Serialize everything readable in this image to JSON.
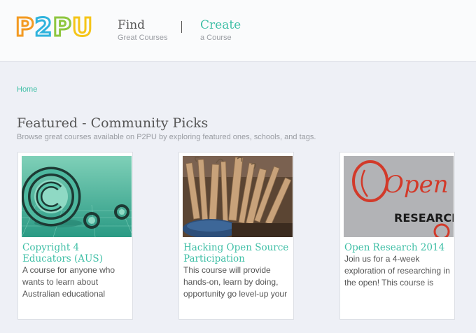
{
  "logo": {
    "letters": [
      {
        "char": "P",
        "color": "#f39a22"
      },
      {
        "char": "2",
        "color": "#2fb3dd"
      },
      {
        "char": "P",
        "color": "#8ec63f"
      },
      {
        "char": "U",
        "color": "#f5c518"
      }
    ]
  },
  "nav": {
    "find": {
      "label": "Find",
      "sub": "Great Courses"
    },
    "create": {
      "label": "Create",
      "sub": "a Course"
    }
  },
  "breadcrumb": {
    "home": "Home"
  },
  "page": {
    "title": "Featured - Community Picks",
    "subtitle": "Browse great courses available on P2PU by exploring featured ones, schools, and tags."
  },
  "colors": {
    "accent": "#3fbfa6"
  },
  "courses": [
    {
      "title": "Copyright 4 Educators (AUS)",
      "description": "A course for anyone who wants to learn about Australian educational"
    },
    {
      "title": "Hacking Open Source Participation",
      "description": "This course will provide hands-on, learn by doing, opportunity go level-up your"
    },
    {
      "title": "Open Research 2014",
      "description": "Join us for a 4-week exploration of researching in the open! This course is"
    }
  ],
  "thumbnail_text": {
    "open": "Open",
    "research": "RESEARCH"
  }
}
